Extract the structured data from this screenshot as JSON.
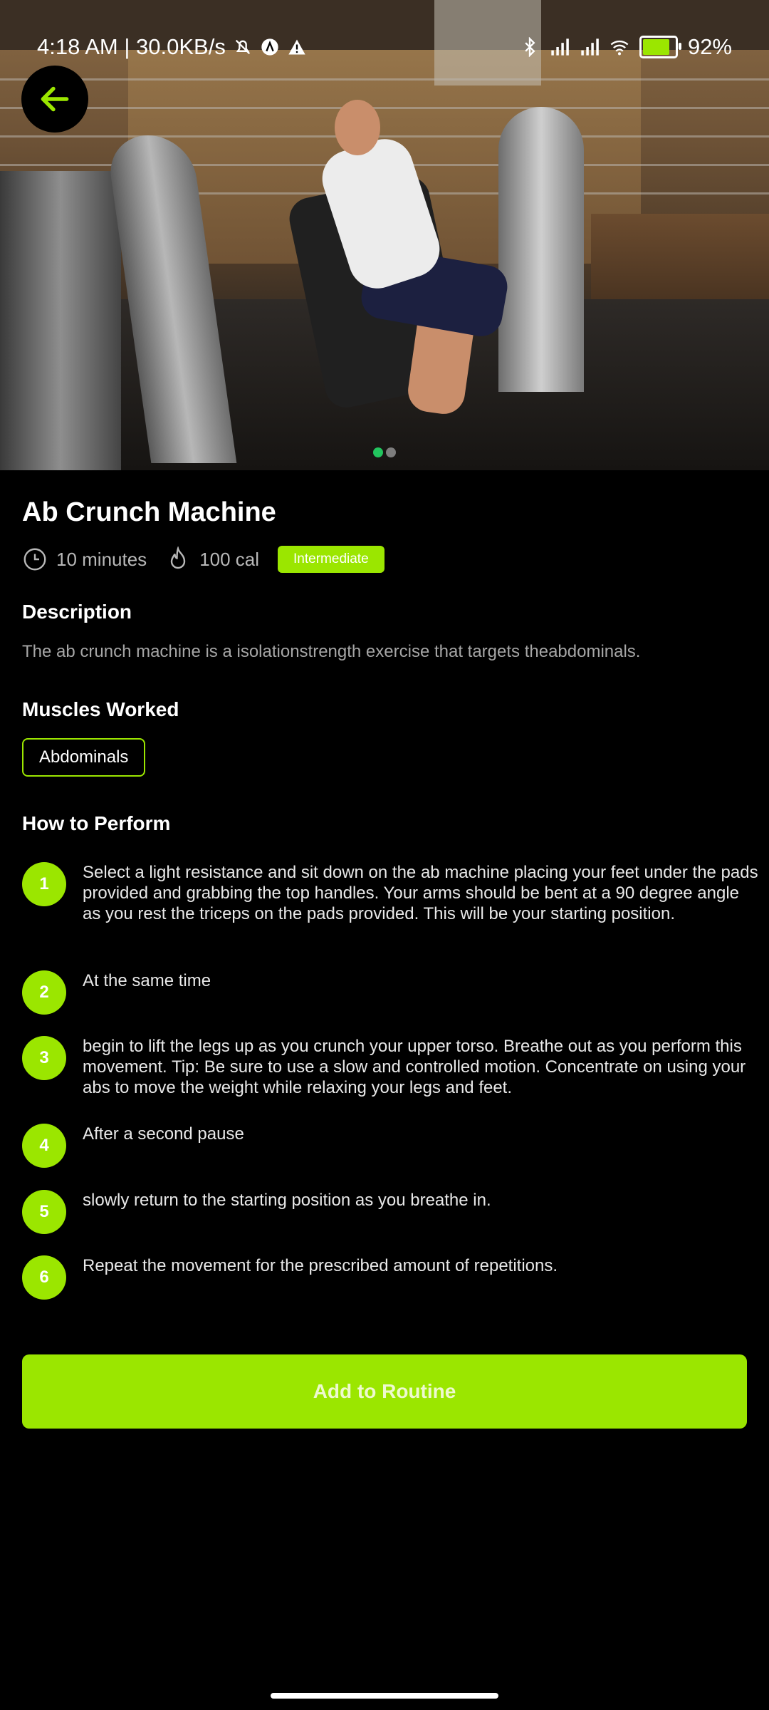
{
  "status_bar": {
    "time_speed": "4:18 AM | 30.0KB/s",
    "battery": "92%"
  },
  "hero": {
    "dots_total": 2,
    "dots_active": 1
  },
  "exercise": {
    "title": "Ab Crunch Machine",
    "duration": "10 minutes",
    "calories": "100 cal",
    "level": "Intermediate"
  },
  "description": {
    "heading": "Description",
    "text": "The ab crunch machine is a isolationstrength exercise that targets theabdominals."
  },
  "muscles": {
    "heading": "Muscles Worked",
    "items": [
      "Abdominals"
    ]
  },
  "how_to": {
    "heading": "How to Perform",
    "steps": [
      {
        "num": "1",
        "text": "Select a light resistance and sit down on the ab machine placing your feet under the pads provided and grabbing the top handles. Your arms should be bent at a 90 degree angle as you rest the triceps on the pads provided. This will be your starting position."
      },
      {
        "num": "2",
        "text": "At the same time"
      },
      {
        "num": "3",
        "text": "begin to lift the legs up as you crunch your upper torso. Breathe out as you perform this movement. Tip: Be sure to use a slow and controlled motion. Concentrate on using your abs to move the weight while relaxing your legs and feet."
      },
      {
        "num": "4",
        "text": "After a second pause"
      },
      {
        "num": "5",
        "text": "slowly return to the starting position as you breathe in."
      },
      {
        "num": "6",
        "text": "Repeat the movement for the prescribed amount of repetitions."
      }
    ]
  },
  "cta": {
    "label": "Add to Routine"
  },
  "colors": {
    "accent": "#9be600",
    "background": "#000000",
    "dot_active": "#22c55e"
  }
}
